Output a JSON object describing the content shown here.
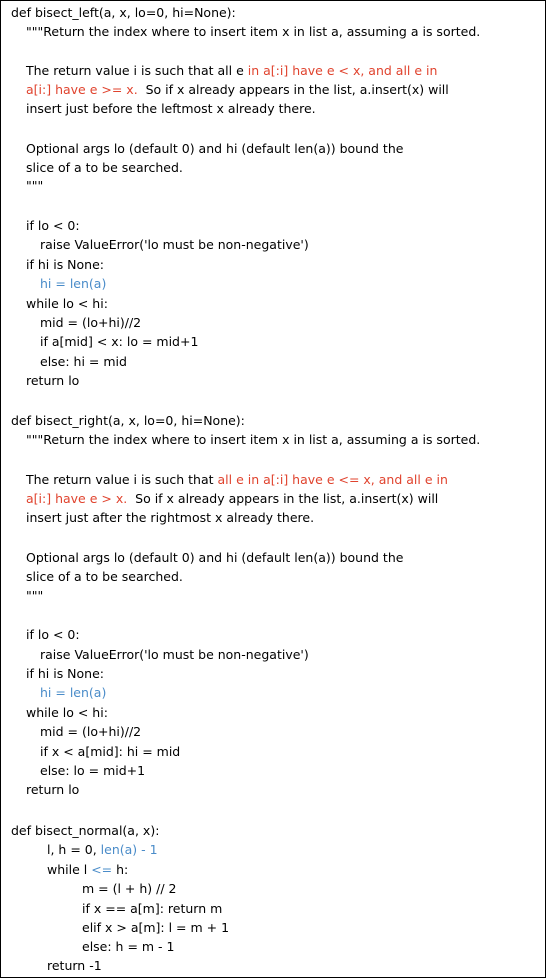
{
  "colors": {
    "text": "#000000",
    "highlight_red": "#e0432e",
    "highlight_blue": "#4a8cc9",
    "background": "#ffffff"
  },
  "code": {
    "f1_def": "def bisect_left(a, x, lo=0, hi=None):",
    "f1_doc1": "\"\"\"Return the index where to insert item x in list a, assuming a is sorted.",
    "f1_doc2_a": "The return value i is such that all e ",
    "f1_doc2_b": "in a[:i] have e < x, and all e in",
    "f1_doc3_a": "a[i:] have e >= x.",
    "f1_doc3_b": "  So if x already appears in the list, a.insert(x) will",
    "f1_doc4": "insert just before the leftmost x already there.",
    "f1_doc5": "Optional args lo (default 0) and hi (default len(a)) bound the",
    "f1_doc6": "slice of a to be searched.",
    "f1_doc7": "\"\"\"",
    "f1_if_lo": "if lo < 0:",
    "f1_raise": "raise ValueError('lo must be non-negative')",
    "f1_if_hi": "if hi is None:",
    "f1_hi_len": "hi = len(a)",
    "f1_while": "while lo < hi:",
    "f1_mid": "mid = (lo+hi)//2",
    "f1_if_amid": "if a[mid] < x: lo = mid+1",
    "f1_else": "else: hi = mid",
    "f1_return": "return lo",
    "f2_def": "def bisect_right(a, x, lo=0, hi=None):",
    "f2_doc1": "\"\"\"Return the index where to insert item x in list a, assuming a is sorted.",
    "f2_doc2_a": "The return value i is such that ",
    "f2_doc2_b": "all e in a[:i] have e <= x, and all e in",
    "f2_doc3_a": "a[i:] have e > x.",
    "f2_doc3_b": "  So if x already appears in the list, a.insert(x) will",
    "f2_doc4": "insert just after the rightmost x already there.",
    "f2_doc5": "Optional args lo (default 0) and hi (default len(a)) bound the",
    "f2_doc6": "slice of a to be searched.",
    "f2_doc7": "\"\"\"",
    "f2_if_lo": "if lo < 0:",
    "f2_raise": "raise ValueError('lo must be non-negative')",
    "f2_if_hi": "if hi is None:",
    "f2_hi_len": "hi = len(a)",
    "f2_while": "while lo < hi:",
    "f2_mid": "mid = (lo+hi)//2",
    "f2_if_x": "if x < a[mid]: hi = mid",
    "f2_else": "else: lo = mid+1",
    "f2_return": "return lo",
    "f3_def": "def bisect_normal(a, x):",
    "f3_init_a": "l, h = 0, ",
    "f3_init_b": "len(a) - 1",
    "f3_while_a": "while l ",
    "f3_while_b": "<=",
    "f3_while_c": " h:",
    "f3_m": "m = (l + h) // 2",
    "f3_if_eq": "if x == a[m]: return m",
    "f3_elif": "elif x > a[m]: l = m + 1",
    "f3_else": "else: h = m - 1",
    "f3_return": "return -1"
  }
}
